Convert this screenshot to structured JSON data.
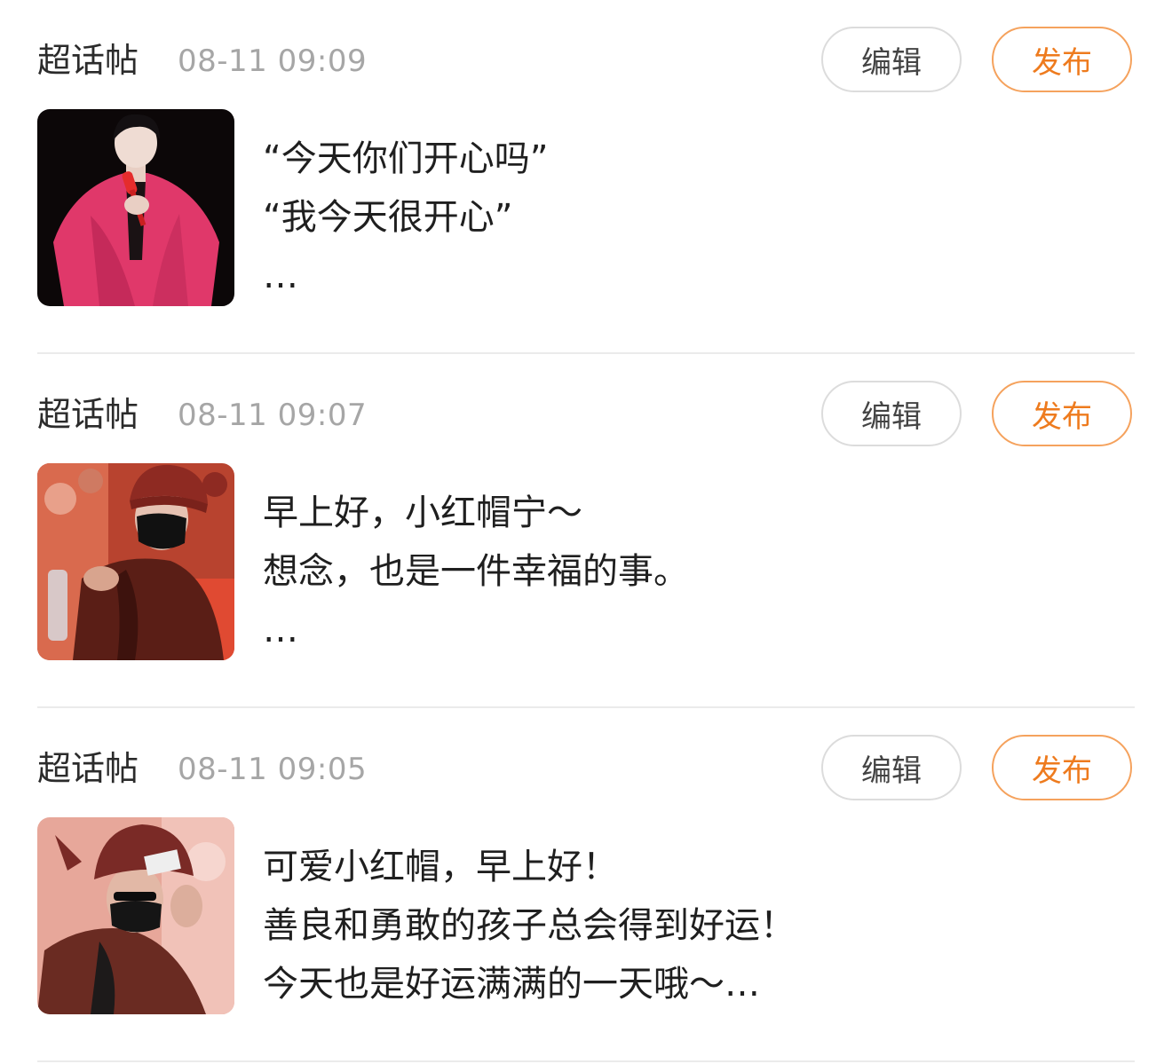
{
  "posts": [
    {
      "type": "超话帖",
      "time": "08-11 09:09",
      "edit_label": "编辑",
      "publish_label": "发布",
      "image": "photo of performer in pink coat holding red microphone",
      "lines": [
        "“今天你们开心吗”",
        "“我今天很开心”",
        "…"
      ]
    },
    {
      "type": "超话帖",
      "time": "08-11 09:07",
      "edit_label": "编辑",
      "publish_label": "发布",
      "image": "photo of person in red knit hat and black face mask",
      "lines": [
        "早上好，小红帽宁～",
        "想念，也是一件幸福的事。",
        "…"
      ]
    },
    {
      "type": "超话帖",
      "time": "08-11 09:05",
      "edit_label": "编辑",
      "publish_label": "发布",
      "image": "photo of person in red knit hat adjusting sunglasses",
      "lines": [
        "可爱小红帽，早上好！",
        "善良和勇敢的孩子总会得到好运！",
        "今天也是好运满满的一天哦～…"
      ]
    }
  ],
  "colors": {
    "publish_accent": "#ee7b1e",
    "publish_border": "#f5a25d",
    "meta_gray": "#a6a6a6",
    "divider": "#ebebeb"
  }
}
